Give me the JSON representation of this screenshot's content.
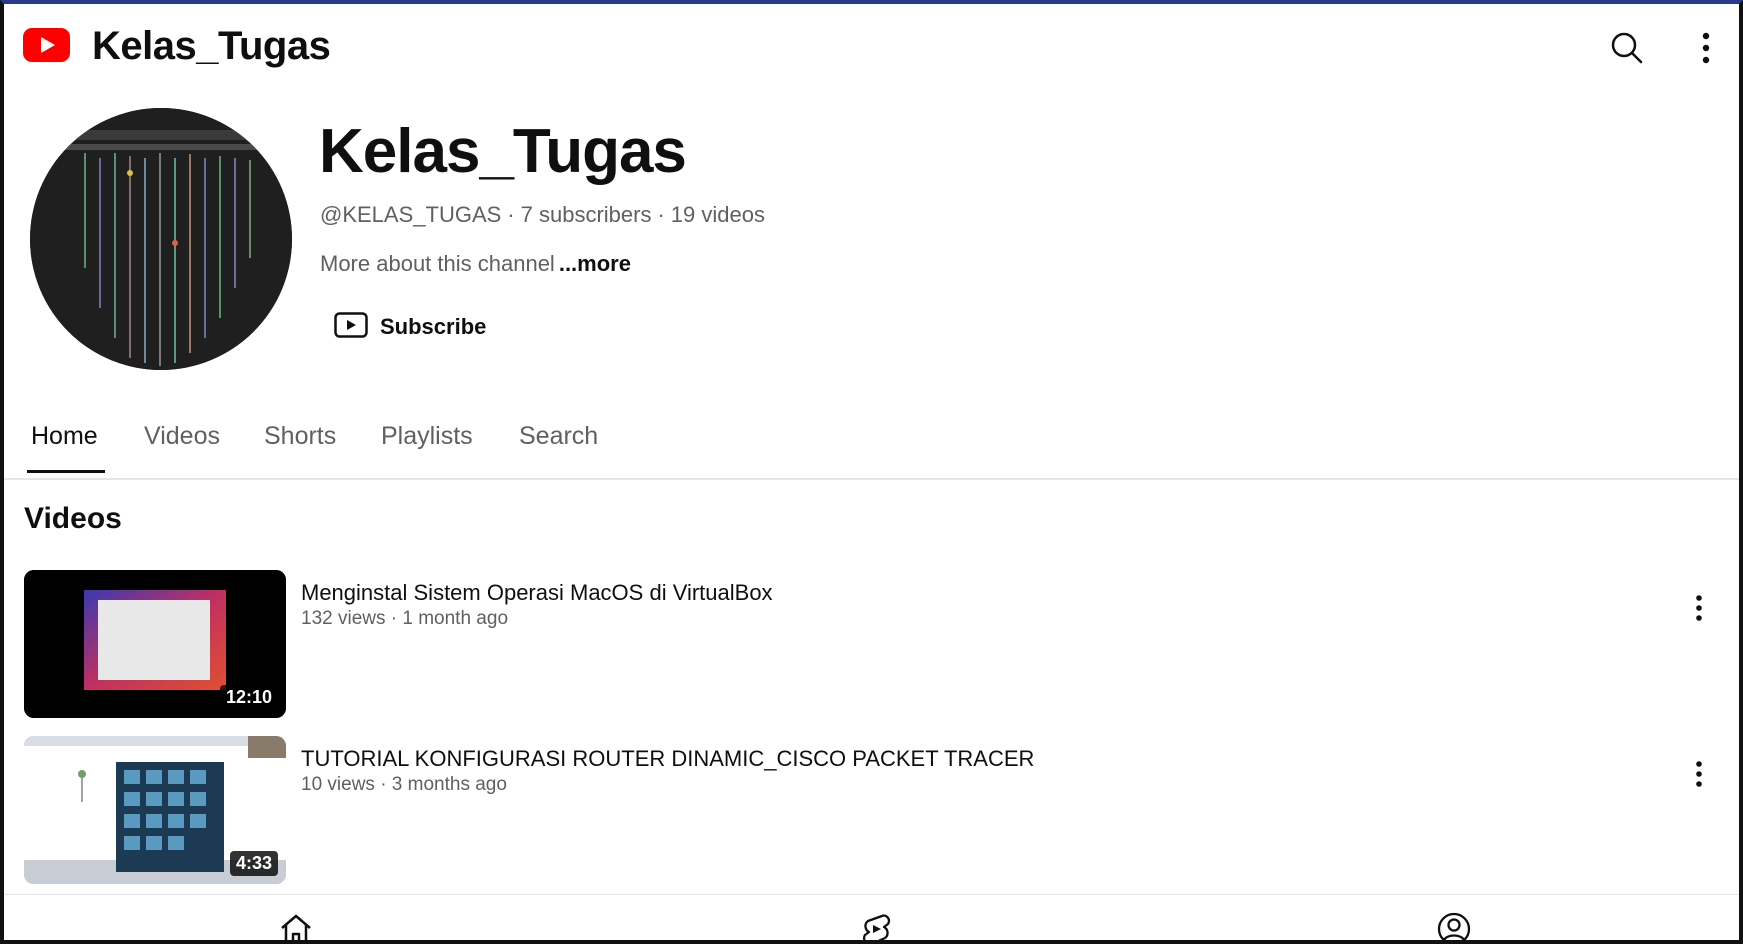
{
  "app": {
    "title": "Kelas_Tugas",
    "logo_icon": "youtube-logo-icon",
    "brand_color": "#ff0000"
  },
  "top_bar": {
    "search_icon": "search-icon",
    "more_icon": "more-vert-icon"
  },
  "channel": {
    "name": "Kelas_Tugas",
    "handle": "@KELAS_TUGAS",
    "subscribers": "7 subscribers",
    "videos_count": "19 videos",
    "separator": "·",
    "about_text": "More about this channel",
    "about_more": "...more",
    "subscribe_label": "Subscribe",
    "subscribe_icon": "play-box-icon"
  },
  "tabs": [
    {
      "label": "Home",
      "active": true
    },
    {
      "label": "Videos",
      "active": false
    },
    {
      "label": "Shorts",
      "active": false
    },
    {
      "label": "Playlists",
      "active": false
    },
    {
      "label": "Search",
      "active": false
    }
  ],
  "section": {
    "title": "Videos"
  },
  "videos": [
    {
      "title": "Menginstal Sistem Operasi MacOS di VirtualBox",
      "meta": "132 views · 1 month ago",
      "duration": "12:10"
    },
    {
      "title": "TUTORIAL KONFIGURASI ROUTER DINAMIC_CISCO PACKET TRACER",
      "meta": "10 views · 3 months ago",
      "duration": "4:33"
    }
  ],
  "bottom_nav": {
    "home_icon": "home-icon",
    "shorts_icon": "shorts-icon",
    "you_icon": "account-circle-icon"
  }
}
